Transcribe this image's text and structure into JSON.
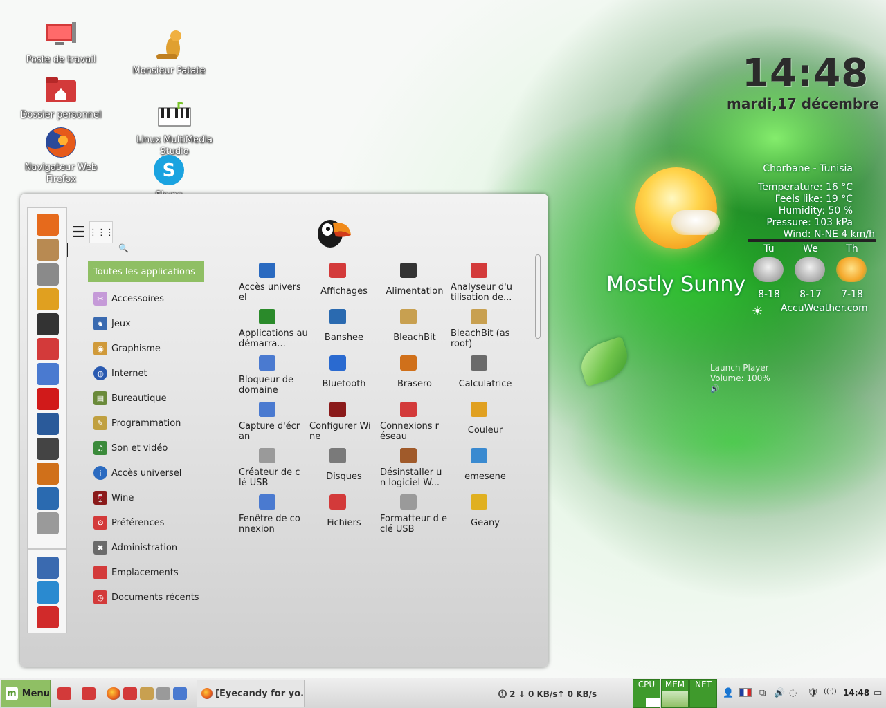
{
  "desktop": {
    "icons": [
      {
        "label": "Poste de travail"
      },
      {
        "label": "Dossier personnel"
      },
      {
        "label": "Navigateur Web Firefox"
      },
      {
        "label": "Monsieur Patate"
      },
      {
        "label": "Linux MultiMedia Studio"
      },
      {
        "label": "Skype"
      }
    ]
  },
  "conky": {
    "time": "14:48",
    "date": "mardi,17 décembre",
    "location": "Chorbane - Tunisia",
    "temperature": "Temperature: 16 °C",
    "feels_like": "Feels like: 19 °C",
    "humidity": "Humidity: 50 %",
    "pressure": "Pressure: 103 kPa",
    "wind": "Wind: N-NE 4 km/h",
    "condition": "Mostly Sunny",
    "forecast": [
      {
        "day": "Tu",
        "temps": "8-18",
        "icon": "cloudy-icon"
      },
      {
        "day": "We",
        "temps": "8-17",
        "icon": "cloudy-icon"
      },
      {
        "day": "Th",
        "temps": "7-18",
        "icon": "sun-icon"
      }
    ],
    "source": "AccuWeather.com",
    "player_line1": "Launch Player",
    "player_line2": "Volume: 100%",
    "speaker_glyph": "🔊"
  },
  "menu": {
    "search_placeholder": "",
    "search_glyph": "🔍",
    "list_view_glyph": "☰",
    "grid_view_glyph": "⋮⋮⋮",
    "favorites": [
      {
        "icon": "firefox-icon",
        "color": "#e66a1c"
      },
      {
        "icon": "package-icon",
        "color": "#b88a52"
      },
      {
        "icon": "settings-tools-icon",
        "color": "#8a8a8a"
      },
      {
        "icon": "xfce-tools-icon",
        "color": "#e0a020"
      },
      {
        "icon": "terminal-icon",
        "color": "#333333"
      },
      {
        "icon": "folder-icon",
        "color": "#d33a3a"
      },
      {
        "icon": "chromium-icon",
        "color": "#4a7ad0"
      },
      {
        "icon": "opera-icon",
        "color": "#d11a1a"
      },
      {
        "icon": "document-icon",
        "color": "#2a5a9a"
      },
      {
        "icon": "lmms-icon",
        "color": "#444444"
      },
      {
        "icon": "brasero-icon",
        "color": "#d0701a"
      },
      {
        "icon": "banshee-icon",
        "color": "#2a6ab0"
      },
      {
        "icon": "keyboard-icon",
        "color": "#9a9a9a"
      }
    ],
    "session_buttons": [
      {
        "icon": "lock-screen-icon",
        "color": "#3a6ab0"
      },
      {
        "icon": "logout-icon",
        "color": "#2a8ad0"
      },
      {
        "icon": "shutdown-icon",
        "color": "#d12a2a"
      }
    ],
    "categories": [
      {
        "label": "Toutes les applications",
        "color": "#8fbf64"
      },
      {
        "label": "Accessoires",
        "color": "#c59ad8"
      },
      {
        "label": "Jeux",
        "color": "#3a6ab0"
      },
      {
        "label": "Graphisme",
        "color": "#d09a3a"
      },
      {
        "label": "Internet",
        "color": "#2a5ab0"
      },
      {
        "label": "Bureautique",
        "color": "#6a8a3a"
      },
      {
        "label": "Programmation",
        "color": "#c0a040"
      },
      {
        "label": "Son et vidéo",
        "color": "#3a8a3a"
      },
      {
        "label": "Accès universel",
        "color": "#2a6ac0"
      },
      {
        "label": "Wine",
        "color": "#8a1a1a"
      },
      {
        "label": "Préférences",
        "color": "#d33a3a"
      },
      {
        "label": "Administration",
        "color": "#6a6a6a"
      },
      {
        "label": "Emplacements",
        "color": "#d33a3a"
      },
      {
        "label": "Documents récents",
        "color": "#d33a3a"
      }
    ],
    "apps": [
      {
        "label": "Accès univers el",
        "color": "#2a6ac0",
        "center": false
      },
      {
        "label": "Affichages",
        "color": "#d33a3a",
        "center": true
      },
      {
        "label": "Alimentation",
        "color": "#333333",
        "center": true
      },
      {
        "label": "Analyseur d'u tilisation de...",
        "color": "#d33a3a",
        "center": false
      },
      {
        "label": "Applications au démarra...",
        "color": "#2a8a2a",
        "center": false
      },
      {
        "label": "Banshee",
        "color": "#2a6ab0",
        "center": true
      },
      {
        "label": "BleachBit",
        "color": "#c8a050",
        "center": true
      },
      {
        "label": "BleachBit (as root)",
        "color": "#c8a050",
        "center": false
      },
      {
        "label": "Bloqueur de domaine",
        "color": "#4a7ad0",
        "center": false
      },
      {
        "label": "Bluetooth",
        "color": "#2a6ad0",
        "center": true
      },
      {
        "label": "Brasero",
        "color": "#d0701a",
        "center": true
      },
      {
        "label": "Calculatrice",
        "color": "#6a6a6a",
        "center": true
      },
      {
        "label": "Capture d'écr an",
        "color": "#4a7ad0",
        "center": false
      },
      {
        "label": "Configurer Wi ne",
        "color": "#8a1a1a",
        "center": false
      },
      {
        "label": "Connexions r éseau",
        "color": "#d33a3a",
        "center": false
      },
      {
        "label": "Couleur",
        "color": "#e0a020",
        "center": true
      },
      {
        "label": "Créateur de c lé USB",
        "color": "#9a9a9a",
        "center": false
      },
      {
        "label": "Disques",
        "color": "#7a7a7a",
        "center": true
      },
      {
        "label": "Désinstaller u n logiciel W...",
        "color": "#a05a2a",
        "center": false
      },
      {
        "label": "emesene",
        "color": "#3a8ad0",
        "center": true
      },
      {
        "label": "Fenêtre de co nnexion",
        "color": "#4a7ad0",
        "center": false
      },
      {
        "label": "Fichiers",
        "color": "#d33a3a",
        "center": true
      },
      {
        "label": "Formatteur d e clé USB",
        "color": "#9a9a9a",
        "center": false
      },
      {
        "label": "Geany",
        "color": "#e0b020",
        "center": true
      }
    ]
  },
  "taskbar": {
    "menu_label": "Menu",
    "menu_glyph": "m",
    "window_title": "[Eyecandy for yo...",
    "net_status": "⓵ 2  ↓ 0 KB/s↑ 0 KB/s",
    "monitors": [
      {
        "label": "CPU"
      },
      {
        "label": "MEM"
      },
      {
        "label": "NET"
      }
    ],
    "tray_user_glyph": "👤",
    "tray_network_glyph": "⧉",
    "tray_volume_glyph": "🔊",
    "tray_update_glyph": "◌",
    "tray_shield_glyph": "🛡",
    "tray_wifi_glyph": "((·))",
    "tray_desktop_glyph": "▭",
    "clock": "14:48"
  }
}
